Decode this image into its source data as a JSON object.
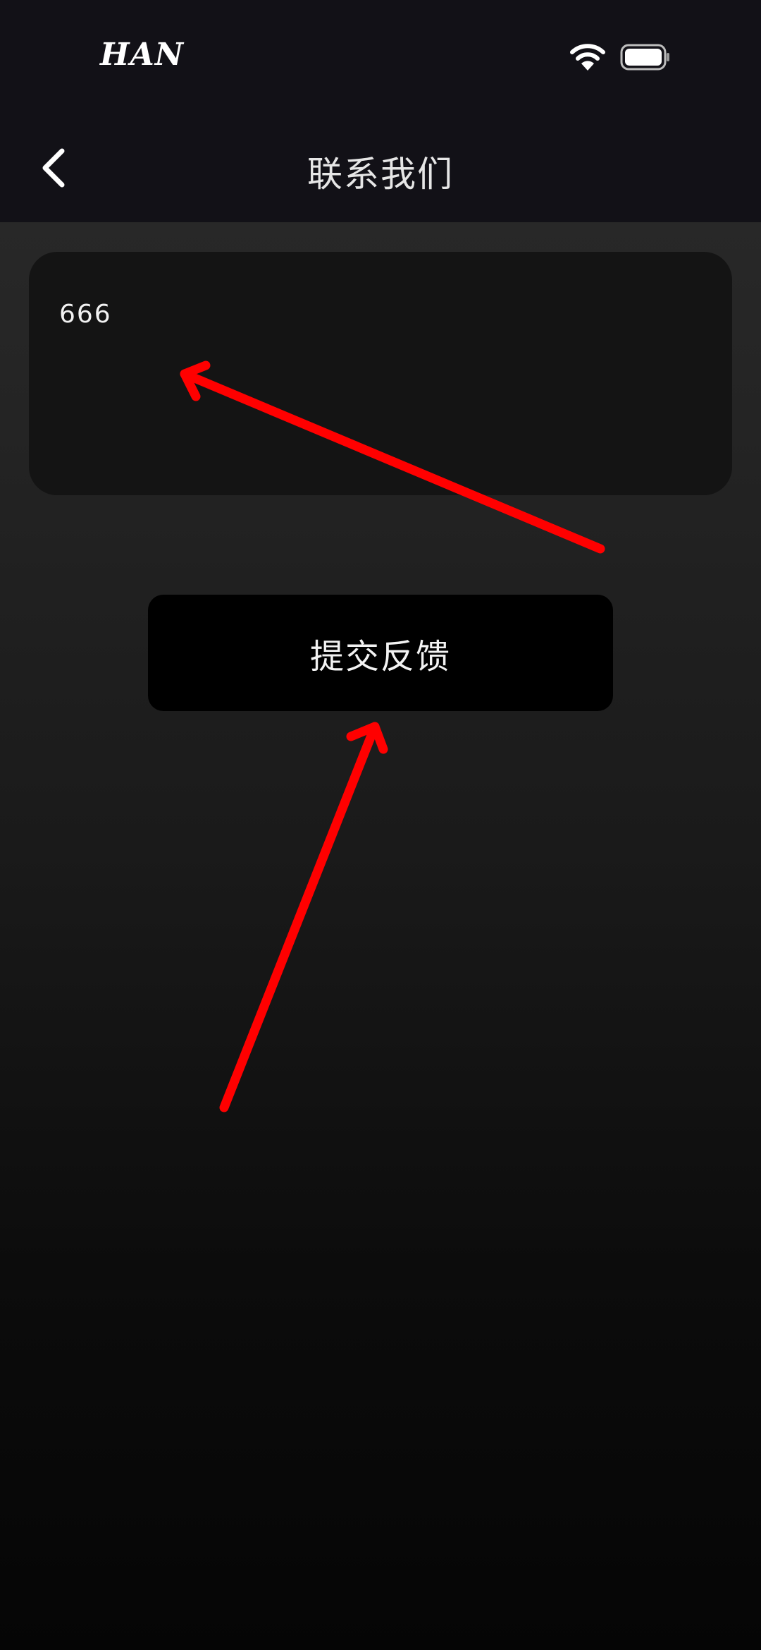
{
  "status_bar": {
    "carrier": "HAN",
    "icons": [
      "wifi-icon",
      "battery-icon"
    ]
  },
  "nav": {
    "back_icon": "chevron-left-icon",
    "title": "联系我们"
  },
  "feedback": {
    "input_value": "666",
    "submit_label": "提交反馈"
  },
  "annotation": {
    "arrow_color": "#ff0000"
  },
  "colors": {
    "topbar_bg": "#121117",
    "input_bg": "#141414",
    "button_bg": "#000000",
    "text": "#f2f2f2"
  }
}
